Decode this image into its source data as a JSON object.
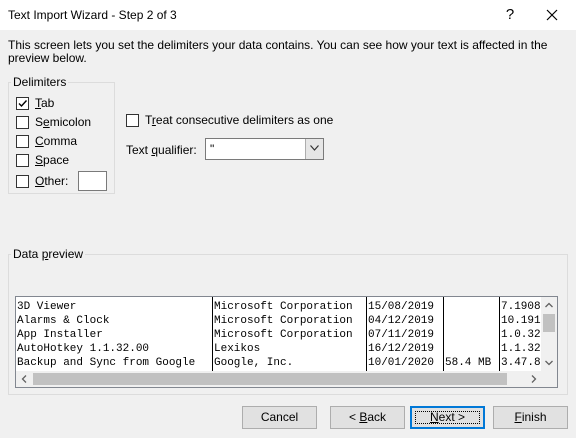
{
  "window": {
    "title": "Text Import Wizard - Step 2 of 3",
    "help_glyph": "?",
    "close_icon": "close-icon"
  },
  "intro": "This screen lets you set the delimiters your data contains.  You can see how your text is affected in the preview below.",
  "delimiters": {
    "title": "Delimiters",
    "tab": {
      "label": "Tab",
      "checked": true
    },
    "semicolon": {
      "label": "Semicolon",
      "checked": false
    },
    "comma": {
      "label": "Comma",
      "checked": false
    },
    "space": {
      "label": "Space",
      "checked": false
    },
    "other": {
      "label": "Other:",
      "checked": false,
      "value": ""
    }
  },
  "consecutive": {
    "label": "Treat consecutive delimiters as one",
    "checked": false
  },
  "qualifier": {
    "label": "Text qualifier:",
    "value": "\""
  },
  "preview": {
    "title": "Data preview",
    "rows": [
      [
        "3D Viewer",
        "Microsoft Corporation",
        "15/08/2019",
        "",
        "7.1908"
      ],
      [
        "Alarms & Clock",
        "Microsoft Corporation",
        "04/12/2019",
        "",
        "10.191"
      ],
      [
        "App Installer",
        "Microsoft Corporation",
        "07/11/2019",
        "",
        "1.0.32"
      ],
      [
        "AutoHotkey 1.1.32.00",
        "Lexikos",
        "16/12/2019",
        "",
        "1.1.32"
      ],
      [
        "Backup and Sync from Google",
        "Google, Inc.",
        "10/01/2020",
        "58.4 MB",
        "3.47.8"
      ]
    ]
  },
  "buttons": {
    "cancel": "Cancel",
    "back": "< Back",
    "next": "Next >",
    "finish": "Finish"
  },
  "colors": {
    "accent": "#0078d7",
    "window_bg": "#f0f0f0"
  }
}
